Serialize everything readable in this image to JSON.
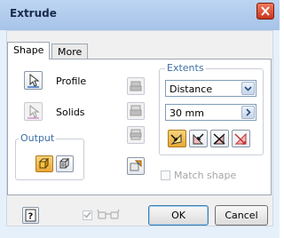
{
  "window": {
    "title": "Extrude"
  },
  "tabs": [
    {
      "label": "Shape"
    },
    {
      "label": "More"
    }
  ],
  "selectors": {
    "profile_label": "Profile",
    "solids_label": "Solids"
  },
  "output": {
    "legend": "Output"
  },
  "extents": {
    "legend": "Extents",
    "type_value": "Distance",
    "distance_value": "30 mm"
  },
  "match_shape": {
    "label": "Match shape",
    "checked": false,
    "enabled": false
  },
  "footer": {
    "ok_label": "OK",
    "cancel_label": "Cancel"
  },
  "colors": {
    "title_bar": "#a6c3e8",
    "close_button": "#d9472b",
    "group_legend": "#3c6ea5",
    "selected_button": "#f0b84a"
  }
}
